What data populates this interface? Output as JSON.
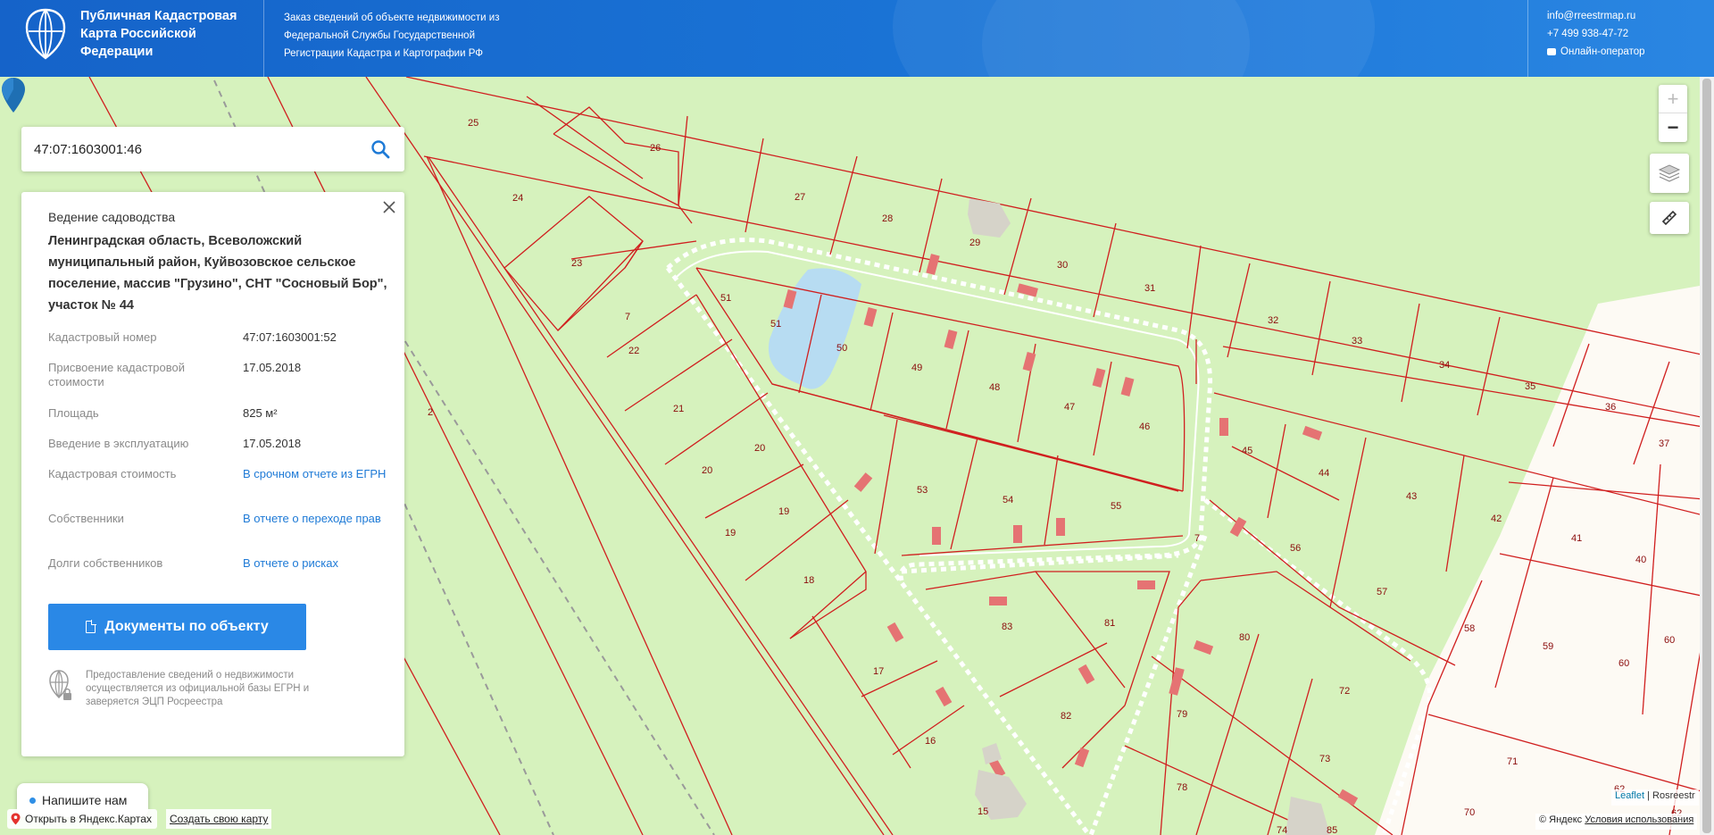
{
  "header": {
    "brand_title": "Публичная Кадастровая Карта Российской Федерации",
    "info_text": "Заказ сведений об объекте недвижимости из Федеральной Службы Государственной Регистрации Кадастра и Картографии РФ",
    "email": "info@rreestrmap.ru",
    "phone": "+7 499 938-47-72",
    "online_operator": "Онлайн-оператор",
    "icons": [
      "globe-shield-logo",
      "chat-icon"
    ],
    "colors": {
      "header_bg": "#1a6fd4",
      "accent": "#2a88e6"
    }
  },
  "search": {
    "value": "47:07:1603001:46",
    "icon": "search-icon"
  },
  "panel": {
    "kind": "Ведение садоводства",
    "address": "Ленинградская область, Всеволожский муниципальный район, Куйвозовское сельское поселение, массив \"Грузино\", СНТ \"Сосновый Бор\", участок № 44",
    "rows": [
      {
        "key": "Кадастровый номер",
        "value": "47:07:1603001:52",
        "link": false
      },
      {
        "key": "Присвоение кадастровой стоимости",
        "value": "17.05.2018",
        "link": false
      },
      {
        "key": "Площадь",
        "value": "825 м²",
        "link": false
      },
      {
        "key": "Введение в эксплуатацию",
        "value": "17.05.2018",
        "link": false
      },
      {
        "key": "Кадастровая стоимость",
        "value": "В срочном отчете из ЕГРН",
        "link": true
      },
      {
        "key": "Собственники",
        "value": "В отчете о переходе прав",
        "link": true
      },
      {
        "key": "Долги собственников",
        "value": "В отчете о рисках",
        "link": true
      }
    ],
    "docs_button": "Документы по объекту",
    "note": "Предоставление сведений о недвижимости осуществляется из официальной базы ЕГРН и заверяется ЭЦП Росреестра"
  },
  "map": {
    "plot_numbers": [
      "25",
      "26",
      "24",
      "23",
      "27",
      "28",
      "29",
      "30",
      "31",
      "32",
      "33",
      "34",
      "35",
      "36",
      "37",
      "51",
      "51",
      "50",
      "49",
      "48",
      "47",
      "46",
      "7",
      "22",
      "21",
      "20",
      "20",
      "19",
      "19",
      "18",
      "2",
      "53",
      "54",
      "55",
      "45",
      "44",
      "43",
      "42",
      "41",
      "40",
      "56",
      "57",
      "58",
      "59",
      "60",
      "60",
      "83",
      "81",
      "80",
      "72",
      "17",
      "16",
      "15",
      "82",
      "79",
      "73",
      "78",
      "74",
      "85",
      "71",
      "70",
      "62",
      "62",
      "7"
    ],
    "zoom_in": "+",
    "zoom_out": "−",
    "controls": [
      "layers-icon",
      "ruler-icon"
    ],
    "colors": {
      "land": "#d6f2bd",
      "boundary": "#d01f1f",
      "building": "#e57373",
      "water": "#b7dcf2",
      "road": "#ffffff"
    }
  },
  "bottom": {
    "chat_button": "Напишите нам",
    "open_in_yandex": "Открыть в Яндекс.Картах",
    "create_map": "Создать свою карту",
    "leaflet": "Leaflet",
    "rosreestr": "Rosreestr",
    "yandex_copyright": "© Яндекс",
    "terms": "Условия использования"
  }
}
